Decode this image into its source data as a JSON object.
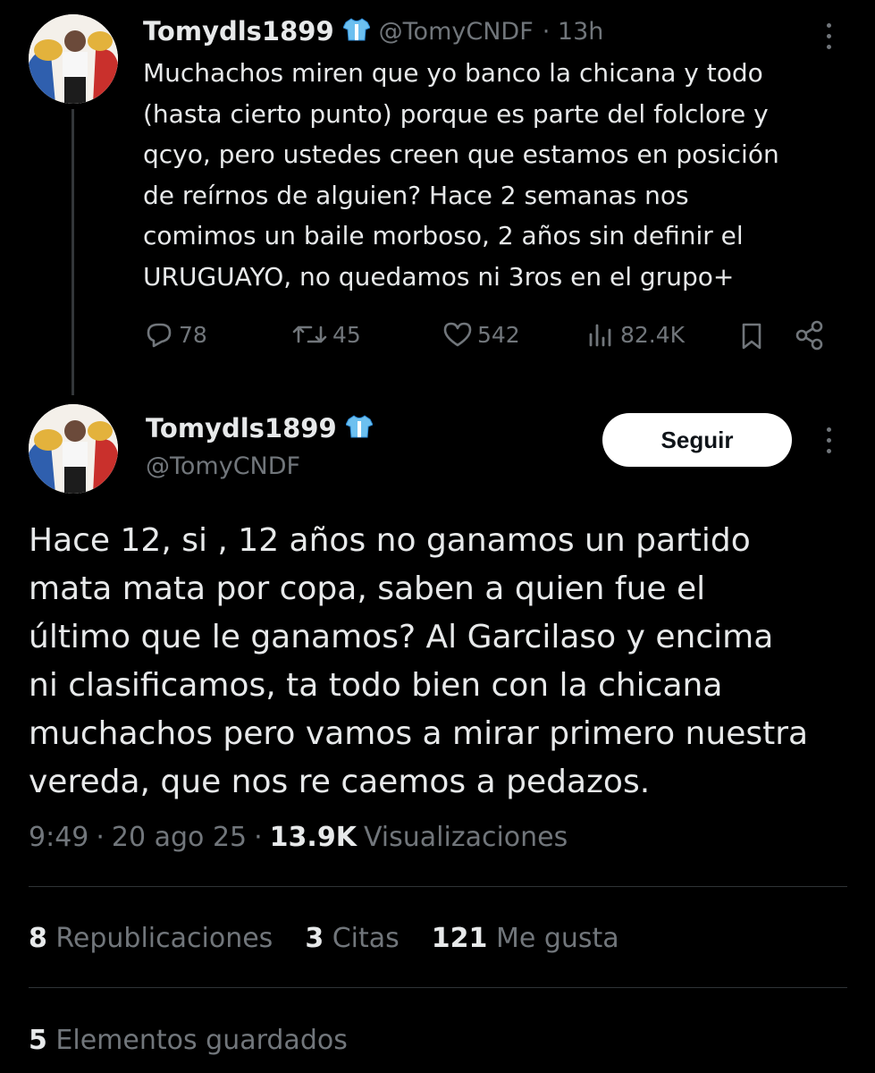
{
  "reply_tweet": {
    "display_name": "Tomydls1899",
    "handle": "@TomyCNDF",
    "time": "· 13h",
    "text_lines": [
      "Muchachos miren que yo banco la chicana y todo",
      "(hasta cierto punto) porque es parte del folclore y",
      "qcyo, pero ustedes creen que estamos en posición",
      "de reírnos de alguien? Hace 2 semanas nos",
      "comimos un baile morboso, 2 años sin definir el",
      "URUGUAYO, no quedamos ni 3ros en el grupo+"
    ],
    "replies": "78",
    "retweets": "45",
    "likes": "542",
    "views": "82.4K"
  },
  "main_tweet": {
    "display_name": "Tomydls1899",
    "handle": "@TomyCNDF",
    "follow_label": "Seguir",
    "text_lines": [
      "Hace 12, si , 12 años no ganamos un partido",
      "mata mata por copa, saben a quien fue el",
      "último que le ganamos? Al Garcilaso y encima",
      "ni clasificamos, ta todo bien con la chicana",
      "muchachos pero vamos a mirar primero nuestra",
      "vereda, que nos re caemos a pedazos."
    ],
    "time": "9:49",
    "date": "20 ago 25",
    "views_count": "13.9K",
    "views_label": "Visualizaciones",
    "reposts_count": "8",
    "reposts_label": "Republicaciones",
    "quotes_count": "3",
    "quotes_label": "Citas",
    "likes_count": "121",
    "likes_label": "Me gusta",
    "bookmarks_count": "5",
    "bookmarks_label": "Elementos guardados"
  },
  "icons": {
    "badge": "jersey-icon",
    "reply": "reply-icon",
    "retweet": "retweet-icon",
    "like": "heart-icon",
    "views": "views-icon",
    "bookmark": "bookmark-icon",
    "share": "share-icon",
    "more": "more-icon"
  },
  "colors": {
    "background": "#000000",
    "text": "#e7e9ea",
    "muted": "#71767b",
    "badge": "#1d9bf0"
  }
}
